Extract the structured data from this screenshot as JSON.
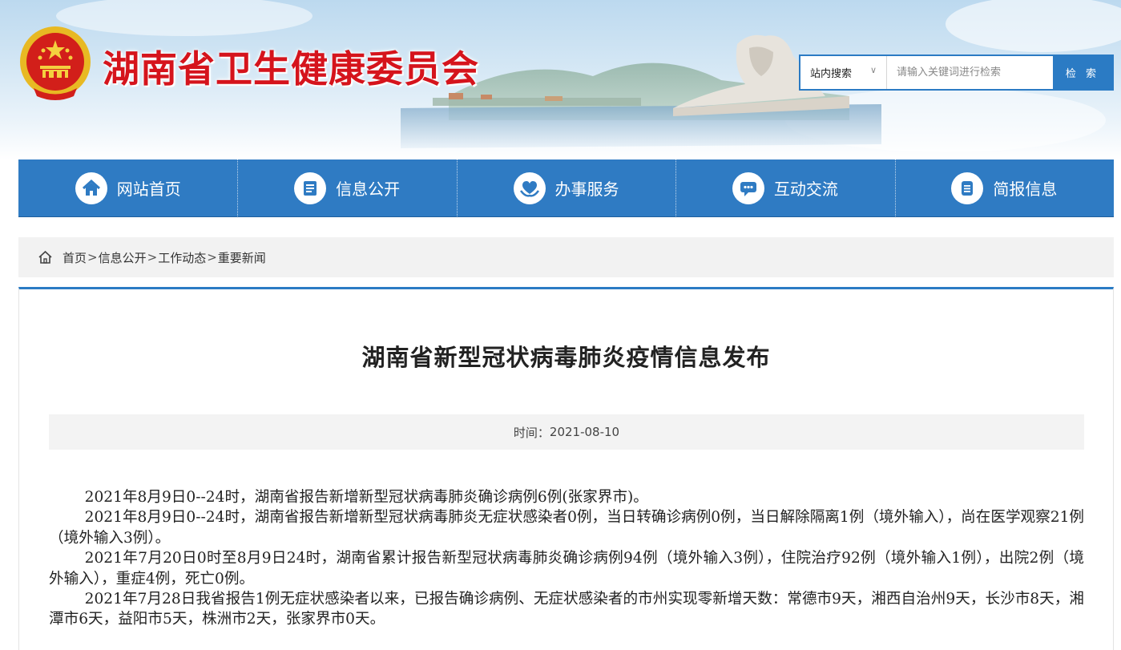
{
  "header": {
    "site_title": "湖南省卫生健康委员会",
    "search": {
      "scope": "站内搜索",
      "placeholder": "请输入关键词进行检索",
      "button": "检 索"
    }
  },
  "nav": {
    "items": [
      {
        "label": "网站首页",
        "icon": "house-icon"
      },
      {
        "label": "信息公开",
        "icon": "document-list-icon"
      },
      {
        "label": "办事服务",
        "icon": "heart-hands-icon"
      },
      {
        "label": "互动交流",
        "icon": "chat-bubble-icon"
      },
      {
        "label": "简报信息",
        "icon": "report-icon"
      }
    ]
  },
  "breadcrumb": {
    "items": [
      "首页",
      "信息公开",
      "工作动态",
      "重要新闻"
    ],
    "separator": ">"
  },
  "article": {
    "title": "湖南省新型冠状病毒肺炎疫情信息发布",
    "time_label": "时间：",
    "time_value": "2021-08-10",
    "paragraphs": [
      "2021年8月9日0--24时，湖南省报告新增新型冠状病毒肺炎确诊病例6例(张家界市)。",
      "2021年8月9日0--24时，湖南省报告新增新型冠状病毒肺炎无症状感染者0例，当日转确诊病例0例，当日解除隔离1例（境外输入），尚在医学观察21例（境外输入3例）。",
      "2021年7月20日0时至8月9日24时，湖南省累计报告新型冠状病毒肺炎确诊病例94例（境外输入3例），住院治疗92例（境外输入1例），出院2例（境外输入），重症4例，死亡0例。",
      "2021年7月28日我省报告1例无症状感染者以来，已报告确诊病例、无症状感染者的市州实现零新增天数：常德市9天，湘西自治州9天，长沙市8天，湘潭市6天，益阳市5天，株洲市2天，张家界市0天。"
    ]
  },
  "colors": {
    "brand_red": "#d5141c",
    "nav_blue": "#2f7bc3",
    "accent_blue": "#2b7bc4"
  }
}
